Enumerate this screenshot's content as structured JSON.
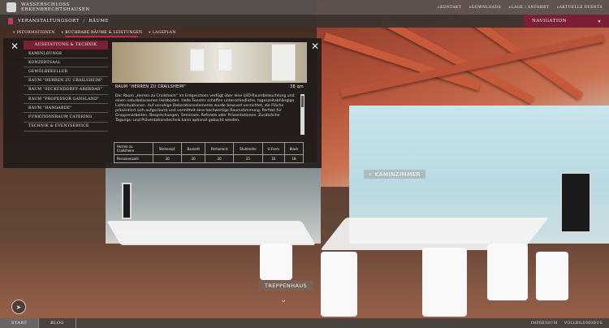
{
  "header": {
    "logo_line1": "WASSERSCHLOSS",
    "logo_line2": "ERKENBRECHTSHAUSEN",
    "links": [
      "KONTAKT",
      "DOWNLOADS",
      "LAGE / ANFAHRT",
      "AKTUELLE EVENTS"
    ]
  },
  "breadcrumb": {
    "first": "VERANSTALTUNGSORT",
    "second": "RÄUME"
  },
  "navigation_label": "NAVIGATION",
  "subtabs": [
    "INFORMATIONEN",
    "BUCHBARE RÄUME & LEISTUNGEN",
    "LAGEPLAN"
  ],
  "menu": {
    "heading": "AUSSTATTUNG & TECHNIK",
    "items": [
      "KAMINLOUNGE",
      "KONZERTSAAL",
      "GEWÖLBEKELLER",
      "RAUM \"HERREN ZU CRAILSHEIM\"",
      "RAUM \"SECKENDORFF-ABERDAR\"",
      "RAUM \"PROFESSOR GANSLAND\"",
      "RAUM \"HANGARDE\"",
      "FUNKTIONSRAUM CATERING",
      "TECHNIK & EVENTSERVICE"
    ]
  },
  "card": {
    "title": "RAUM \"HERREN ZU CRAILSHEIM\"",
    "area": "38 qm",
    "text": "Der Raum „Herren zu Crailsheim“ im Erdgeschoss verfügt über eine LED-Raumbeleuchtung und einen naturbelassenen Holzboden. Helle Fenster schaffen unterschiedliche, tageszeitabhängige Lichtsituationen. Auf unruhige Dekorationselemente wurde bewusst verzichtet, die Fläche präsentiert sich aufgeräumt und vermittelt eine hochwertige Raumstimmung. Perfekt für Gruppenarbeiten, Besprechungen, Seminare, Referate oder Präsentationen. Zusätzliche Tagungs- und Präsentationstechnik kann optional gebucht werden.",
    "table": {
      "header": [
        "Herren zu Crailsheim",
        "Stehempf.",
        "Bankett",
        "Parlament",
        "Stuhlreihe",
        "U-Form",
        "Block"
      ],
      "row": [
        "Personenzahl",
        "30",
        "20",
        "20",
        "25",
        "16",
        "18"
      ]
    }
  },
  "scene": {
    "room_label": "KAMINZIMMER",
    "stairs_label": "TREPPENHAUS"
  },
  "footer": {
    "tabs": [
      "START",
      "BLOG"
    ],
    "links": [
      "IMPRESSUM",
      "VOLLBILDMODUS"
    ]
  },
  "colors": {
    "accent": "#7a1f34",
    "accent_bright": "#b12c4b"
  }
}
